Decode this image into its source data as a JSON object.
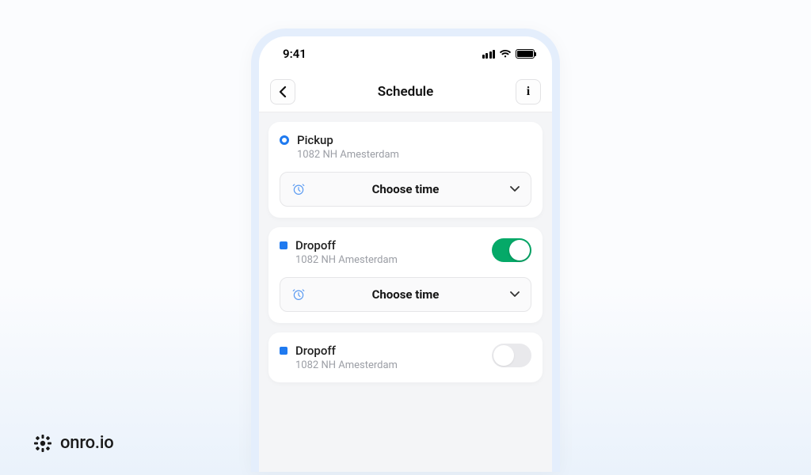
{
  "status": {
    "time": "9:41"
  },
  "nav": {
    "title": "Schedule"
  },
  "stops": [
    {
      "type": "pickup",
      "title": "Pickup",
      "address": "1082 NH Amesterdam",
      "timeLabel": "Choose  time",
      "hasToggle": false,
      "hasTimeBtn": true
    },
    {
      "type": "dropoff",
      "title": "Dropoff",
      "address": "1082 NH Amesterdam",
      "timeLabel": "Choose  time",
      "hasToggle": true,
      "toggleOn": true,
      "hasTimeBtn": true
    },
    {
      "type": "dropoff",
      "title": "Dropoff",
      "address": "1082 NH Amesterdam",
      "hasToggle": true,
      "toggleOn": false,
      "hasTimeBtn": false
    }
  ],
  "brand": {
    "text": "onro.io"
  }
}
